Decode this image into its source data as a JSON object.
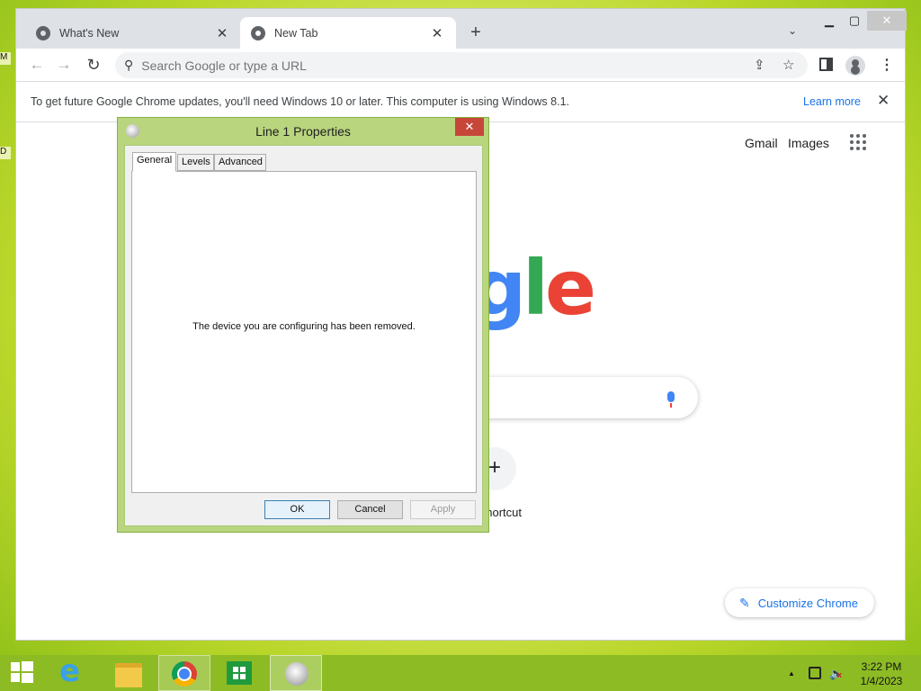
{
  "desktop": {
    "edge_label_1": "M",
    "edge_label_2": "D"
  },
  "chrome": {
    "tabs": [
      {
        "title": "What's New"
      },
      {
        "title": "New Tab"
      }
    ],
    "omnibox": {
      "placeholder": "Search Google or type a URL"
    },
    "infobar": {
      "message": "To get future Google Chrome updates, you'll need Windows 10 or later. This computer is using Windows 8.1.",
      "link": "Learn more"
    },
    "ntp": {
      "gmail": "Gmail",
      "images": "Images",
      "logo_parts": [
        "g",
        "l",
        "e"
      ],
      "shortcut_label": "ld shortcut",
      "customize": "Customize Chrome"
    }
  },
  "dialog": {
    "title": "Line 1 Properties",
    "tabs": [
      "General",
      "Levels",
      "Advanced"
    ],
    "message": "The device you are configuring has been removed.",
    "buttons": {
      "ok": "OK",
      "cancel": "Cancel",
      "apply": "Apply"
    }
  },
  "taskbar": {
    "time": "3:22 PM",
    "date": "1/4/2023"
  }
}
